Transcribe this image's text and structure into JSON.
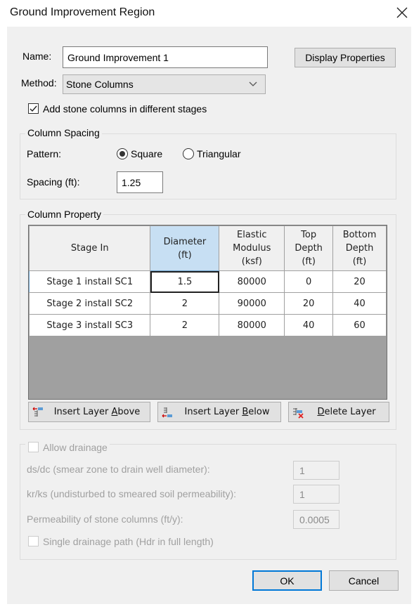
{
  "window": {
    "title": "Ground Improvement Region",
    "close_icon": "close-x-icon"
  },
  "general": {
    "name_label": "Name:",
    "name_value": "Ground Improvement 1",
    "display_properties_label": "Display Properties",
    "method_label": "Method:",
    "method_value": "Stone Columns",
    "stages_checkbox_label": "Add stone columns in different stages",
    "stages_checked": true
  },
  "column_spacing": {
    "group_title": "Column Spacing",
    "pattern_label": "Pattern:",
    "pattern_options": [
      {
        "label": "Square",
        "selected": true
      },
      {
        "label": "Triangular",
        "selected": false
      }
    ],
    "spacing_label": "Spacing (ft):",
    "spacing_value": "1.25"
  },
  "column_property": {
    "group_title": "Column Property",
    "headers": [
      [
        "Stage In"
      ],
      [
        "Diameter",
        "(ft)"
      ],
      [
        "Elastic",
        "Modulus",
        "(ksf)"
      ],
      [
        "Top",
        "Depth",
        "(ft)"
      ],
      [
        "Bottom",
        "Depth",
        "(ft)"
      ]
    ],
    "selected_column": 1,
    "rows": [
      [
        "Stage 1 install SC1",
        "1.5",
        "80000",
        "0",
        "20"
      ],
      [
        "Stage 2 install SC2",
        "2",
        "90000",
        "20",
        "40"
      ],
      [
        "Stage 3 install SC3",
        "2",
        "80000",
        "40",
        "60"
      ]
    ],
    "buttons": {
      "insert_above": {
        "pre": "Insert Layer ",
        "mnemonic": "A",
        "post": "bove"
      },
      "insert_below": {
        "pre": "Insert Layer ",
        "mnemonic": "B",
        "post": "elow"
      },
      "delete": {
        "pre": "",
        "mnemonic": "D",
        "post": "elete Layer"
      }
    }
  },
  "drainage": {
    "allow_label": "Allow drainage",
    "allow_checked": false,
    "ds_dc_label": "ds/dc (smear zone to drain well diameter):",
    "ds_dc_value": "1",
    "kr_ks_label": "kr/ks (undisturbed to smeared soil permeability):",
    "kr_ks_value": "1",
    "permeability_label": "Permeability of stone columns (ft/y):",
    "permeability_value": "0.0005",
    "single_path_label": "Single drainage path (Hdr in full length)",
    "single_path_checked": false
  },
  "footer": {
    "ok_label": "OK",
    "cancel_label": "Cancel"
  }
}
